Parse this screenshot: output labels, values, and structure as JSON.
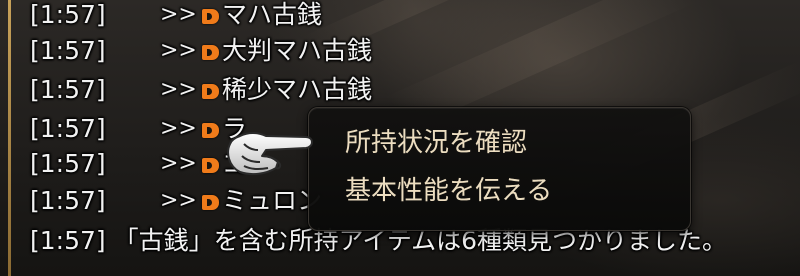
{
  "chat_log": {
    "lines": [
      {
        "timestamp": "[1:57]",
        "arrow": ">>",
        "item": "マハ古銭"
      },
      {
        "timestamp": "[1:57]",
        "arrow": ">>",
        "item": "大判マハ古銭"
      },
      {
        "timestamp": "[1:57]",
        "arrow": ">>",
        "item": "稀少マハ古銭"
      },
      {
        "timestamp": "[1:57]",
        "arrow": ">>",
        "item": "ラ"
      },
      {
        "timestamp": "[1:57]",
        "arrow": ">>",
        "item": "ゴ"
      },
      {
        "timestamp": "[1:57]",
        "arrow": ">>",
        "item": "ミュロン"
      }
    ],
    "summary": {
      "timestamp": "[1:57]",
      "text": "「古銭」を含む所持アイテムは6種類見つかりました。"
    }
  },
  "context_menu": {
    "items": [
      {
        "label": "所持状況を確認"
      },
      {
        "label": "基本性能を伝える"
      }
    ]
  },
  "colors": {
    "chat_text": "#f2f2f2",
    "menu_text": "#ecddc0",
    "item_icon": "#f07b1a",
    "border_accent": "#c8a25a"
  },
  "icons": {
    "item_link": "item-link-icon",
    "cursor": "pointing-hand-cursor-icon"
  }
}
